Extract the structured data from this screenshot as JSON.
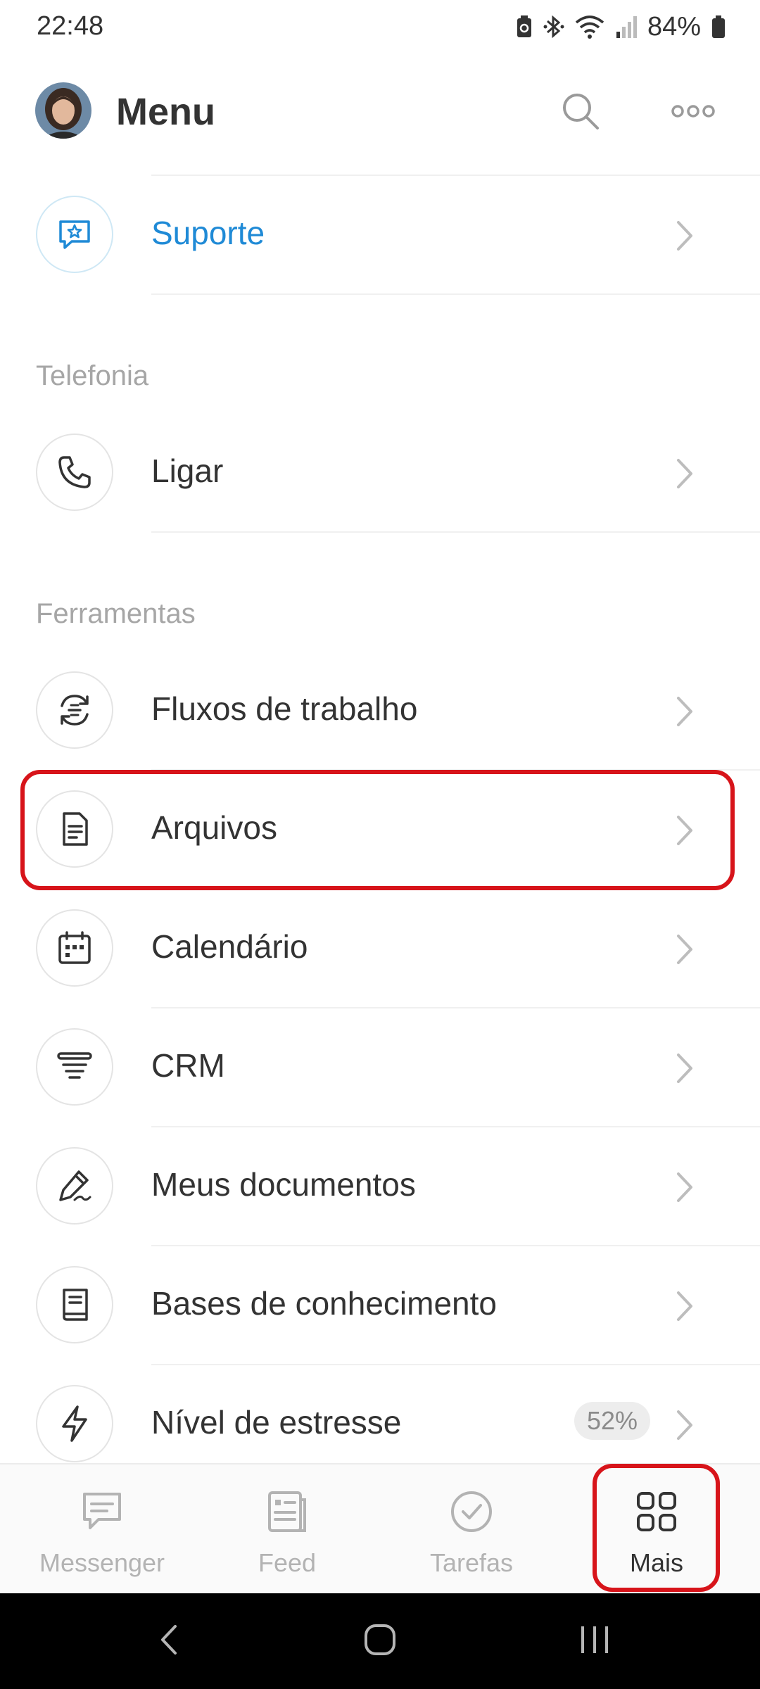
{
  "status_bar": {
    "time": "22:48",
    "battery": "84%",
    "icons": [
      "battery-saver-icon",
      "bluetooth-icon",
      "wifi-icon",
      "signal-icon",
      "battery-icon"
    ]
  },
  "header": {
    "title": "Menu",
    "search_icon": "search-icon",
    "more_icon": "more-options-icon"
  },
  "menu": {
    "support": {
      "label": "Suporte",
      "icon": "support-star-chat-icon"
    },
    "telefonia": {
      "section_label": "Telefonia",
      "items": [
        {
          "label": "Ligar",
          "icon": "phone-icon"
        }
      ]
    },
    "ferramentas": {
      "section_label": "Ferramentas",
      "items": [
        {
          "label": "Fluxos de trabalho",
          "icon": "workflow-icon"
        },
        {
          "label": "Arquivos",
          "icon": "document-icon"
        },
        {
          "label": "Calendário",
          "icon": "calendar-icon"
        },
        {
          "label": "CRM",
          "icon": "crm-funnel-icon"
        },
        {
          "label": "Meus documentos",
          "icon": "signature-pen-icon"
        },
        {
          "label": "Bases de conhecimento",
          "icon": "book-icon"
        },
        {
          "label": "Nível de estresse",
          "icon": "lightning-icon",
          "badge": "52%"
        }
      ]
    }
  },
  "bottom_nav": {
    "items": [
      {
        "label": "Messenger",
        "icon": "chat-bubble-icon",
        "active": false
      },
      {
        "label": "Feed",
        "icon": "feed-news-icon",
        "active": false
      },
      {
        "label": "Tarefas",
        "icon": "check-circle-icon",
        "active": false
      },
      {
        "label": "Mais",
        "icon": "grid-icon",
        "active": true
      }
    ]
  },
  "colors": {
    "accent_blue": "#1f8ad6",
    "highlight_red": "#d7141a",
    "section_gray": "#a6a6a6"
  }
}
